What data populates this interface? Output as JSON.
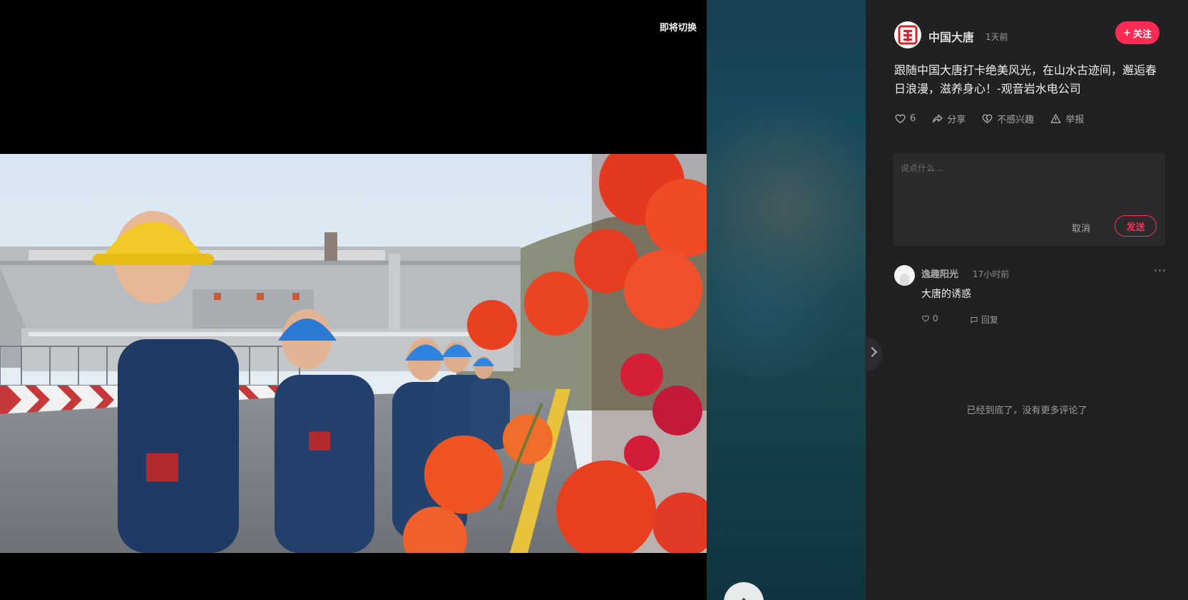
{
  "video": {
    "switch_hint": "即将切换"
  },
  "author": {
    "name": "中国大唐",
    "time": "1天前",
    "follow_label": "关注"
  },
  "post": {
    "title": "跟随中国大唐打卡绝美风光，在山水古迹间，邂逅春日浪漫，滋养身心！-观音岩水电公司"
  },
  "actions": {
    "like_count": "6",
    "share_label": "分享",
    "dislike_label": "不感兴趣",
    "report_label": "举报"
  },
  "comment_box": {
    "placeholder": "说点什么...",
    "cancel_label": "取消",
    "send_label": "发送"
  },
  "comments": [
    {
      "user": "逸趣阳光",
      "time": "17小时前",
      "text": "大唐的诱惑",
      "likes": "0",
      "reply_label": "回复"
    }
  ],
  "end_note": "已经到底了，没有更多评论了",
  "colors": {
    "accent": "#fe2c55",
    "panel_bg": "#212123",
    "video_bg": "#000000"
  },
  "icons": [
    "heart-icon",
    "share-icon",
    "broken-heart-icon",
    "warning-icon",
    "more-icon",
    "reply-icon",
    "chevron-right-icon",
    "chevron-up-icon",
    "brand-logo"
  ]
}
